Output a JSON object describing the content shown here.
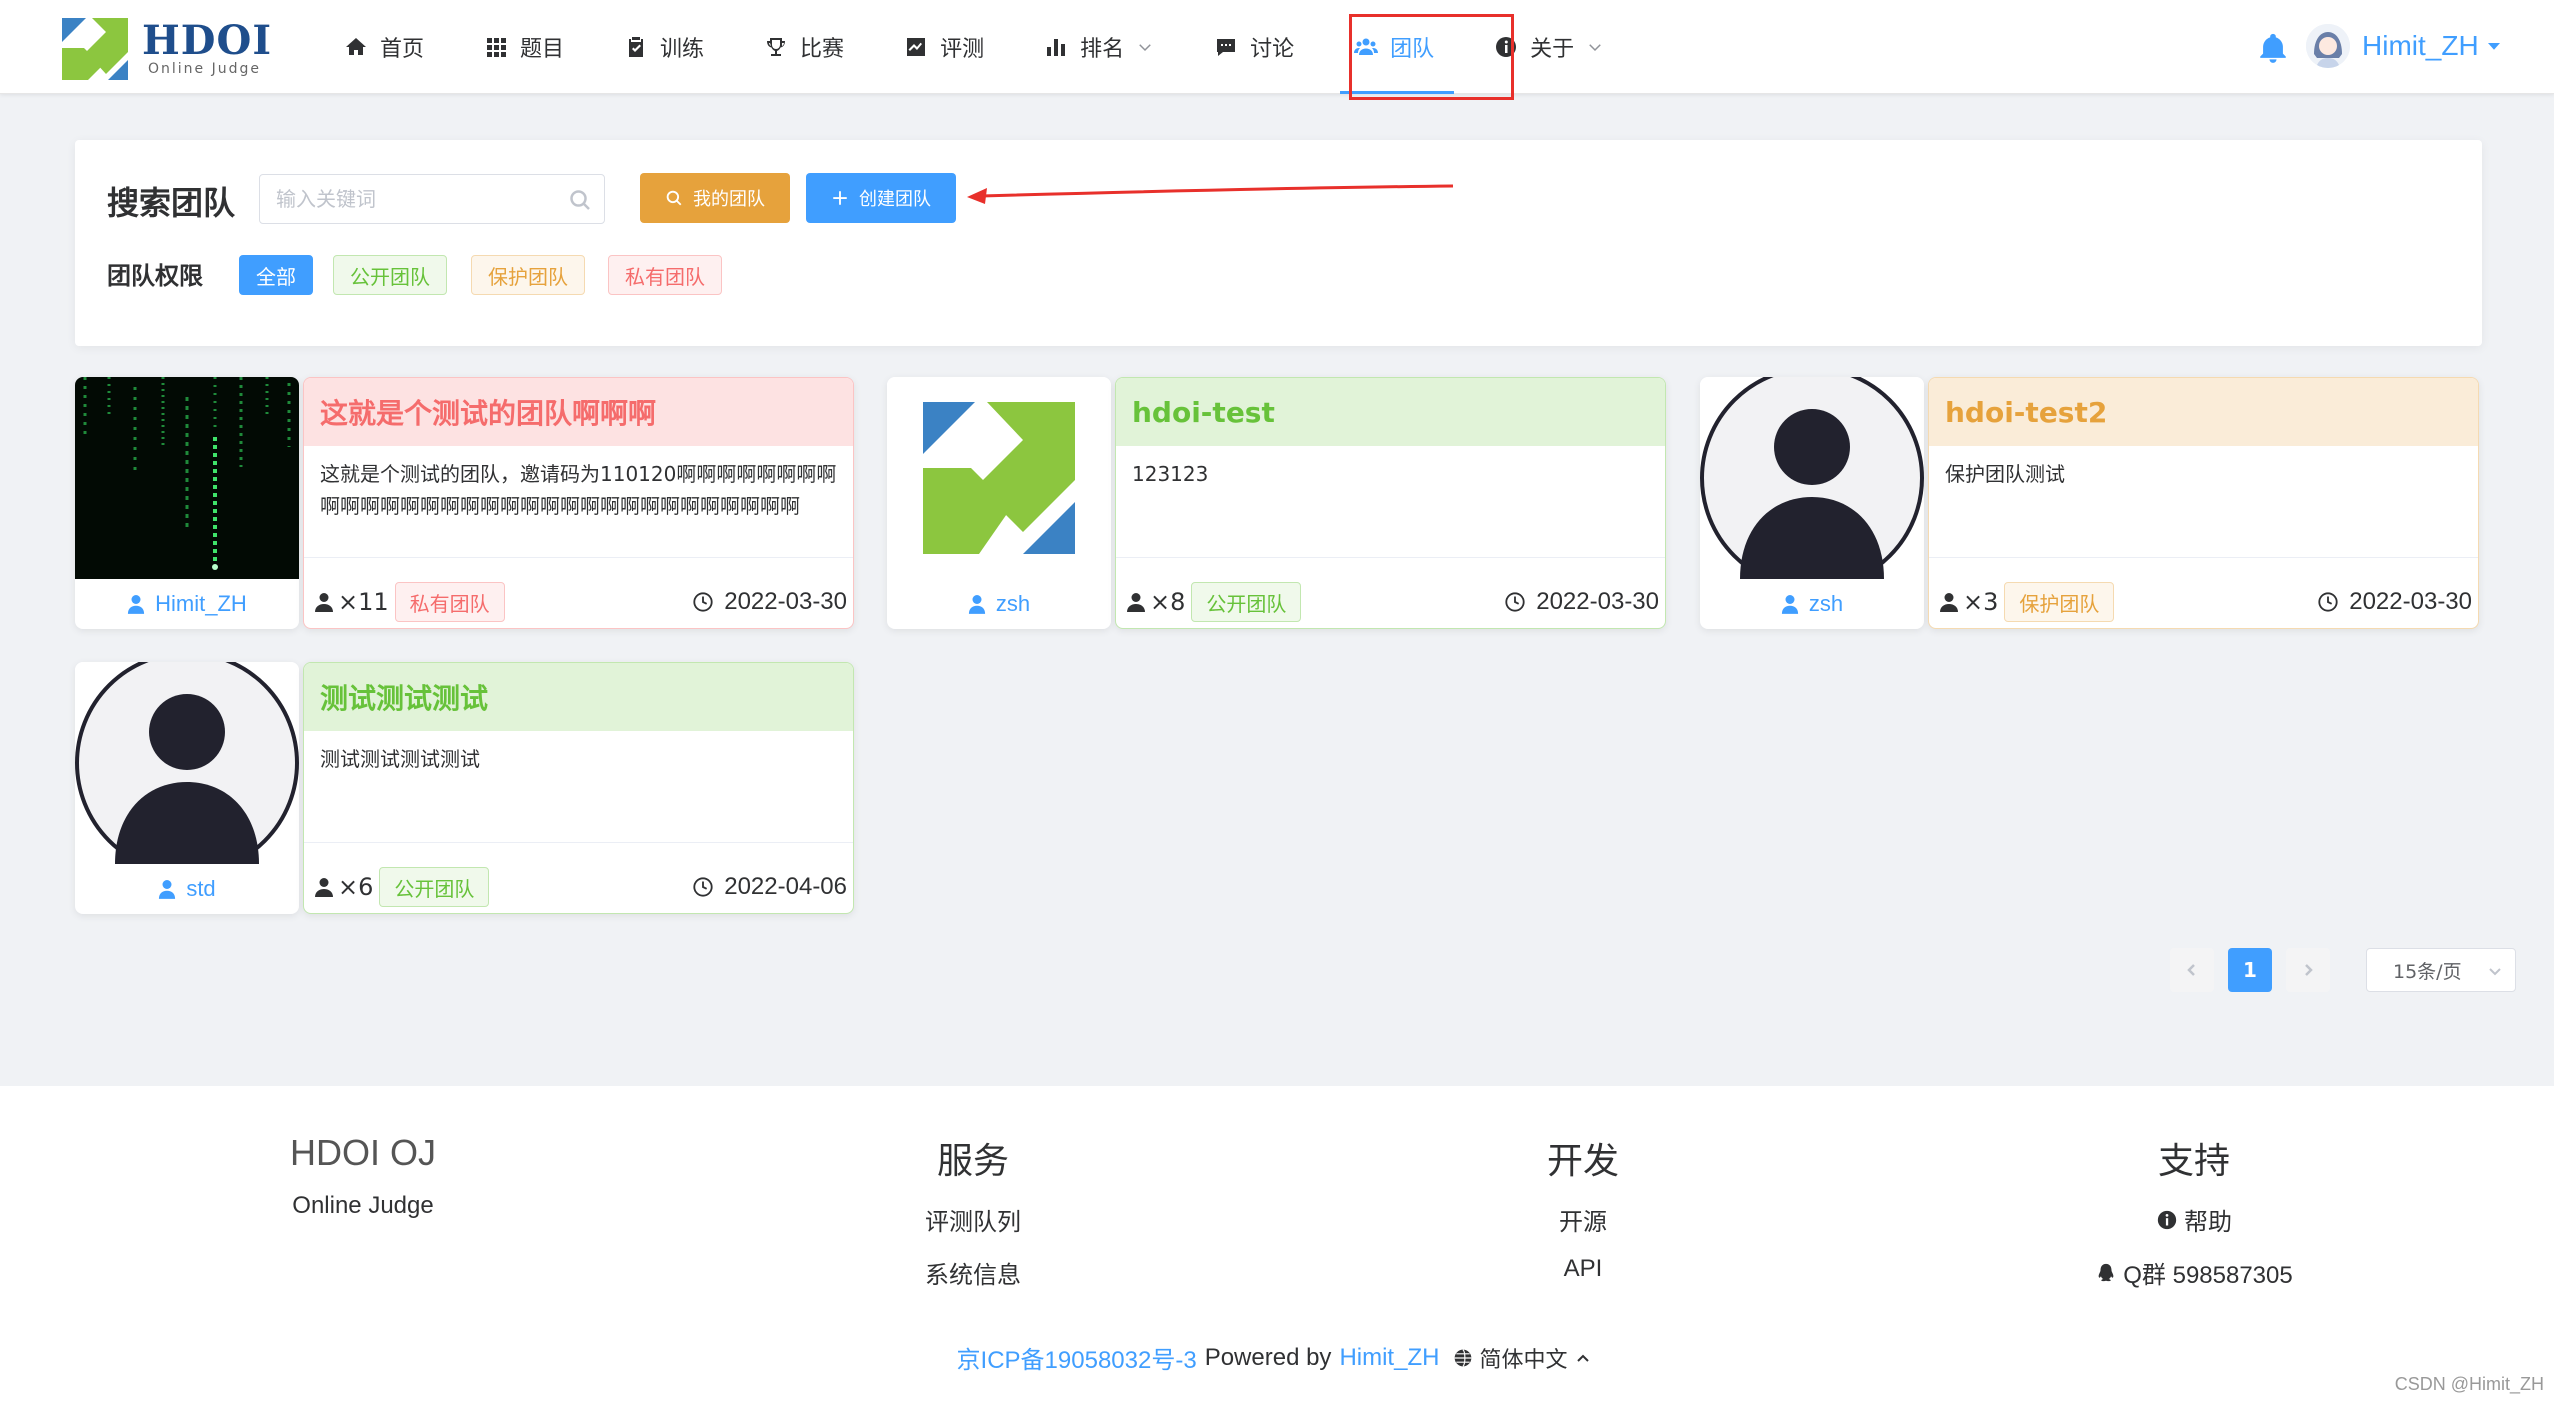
{
  "logo": {
    "title": "HDOI",
    "subtitle": "Online Judge"
  },
  "nav": [
    {
      "label": "首页",
      "icon": "home-icon"
    },
    {
      "label": "题目",
      "icon": "grid-icon"
    },
    {
      "label": "训练",
      "icon": "clipboard-icon"
    },
    {
      "label": "比赛",
      "icon": "trophy-icon"
    },
    {
      "label": "评测",
      "icon": "chart-line-icon"
    },
    {
      "label": "排名",
      "icon": "bar-chart-icon"
    },
    {
      "label": "讨论",
      "icon": "comment-icon"
    },
    {
      "label": "团队",
      "icon": "users-icon",
      "active": true
    },
    {
      "label": "关于",
      "icon": "info-icon"
    }
  ],
  "user": {
    "name": "Himit_ZH"
  },
  "search": {
    "title": "搜索团队",
    "placeholder": "输入关键词",
    "my_team": "我的团队",
    "create_team": "创建团队",
    "perm_title": "团队权限",
    "tags": {
      "all": "全部",
      "public": "公开团队",
      "protect": "保护团队",
      "private": "私有团队"
    }
  },
  "teams": [
    {
      "name": "这就是个测试的团队啊啊啊",
      "desc": "这就是个测试的团队，邀请码为110120啊啊啊啊啊啊啊啊啊啊啊啊啊啊啊啊啊啊啊啊啊啊啊啊啊啊啊啊啊啊啊啊",
      "owner": "Himit_ZH",
      "count": "×11",
      "perm": "私有团队",
      "date": "2022-03-30"
    },
    {
      "name": "hdoi-test",
      "desc": "123123",
      "owner": "zsh",
      "count": "×8",
      "perm": "公开团队",
      "date": "2022-03-30"
    },
    {
      "name": "hdoi-test2",
      "desc": "保护团队测试",
      "owner": "zsh",
      "count": "×3",
      "perm": "保护团队",
      "date": "2022-03-30"
    },
    {
      "name": "测试测试测试",
      "desc": "测试测试测试测试",
      "owner": "std",
      "count": "×6",
      "perm": "公开团队",
      "date": "2022-04-06"
    }
  ],
  "pagination": {
    "current": "1",
    "page_size": "15条/页"
  },
  "footer": {
    "col1": {
      "title": "HDOI OJ",
      "link": "Online Judge"
    },
    "col2": {
      "title": "服务",
      "links": [
        "评测队列",
        "系统信息"
      ]
    },
    "col3": {
      "title": "开发",
      "links": [
        "开源",
        "API"
      ]
    },
    "col4": {
      "title": "支持",
      "help": "帮助",
      "qq": "Q群 598587305"
    },
    "icp": "京ICP备19058032号-3",
    "powered": "Powered by",
    "author": "Himit_ZH",
    "lang": "简体中文"
  },
  "watermark": "CSDN @Himit_ZH",
  "colors": {
    "primary": "#409eff",
    "warning": "#e6a23c",
    "success": "#67c23a",
    "danger": "#f56c6c",
    "annotation": "#e8302b"
  }
}
